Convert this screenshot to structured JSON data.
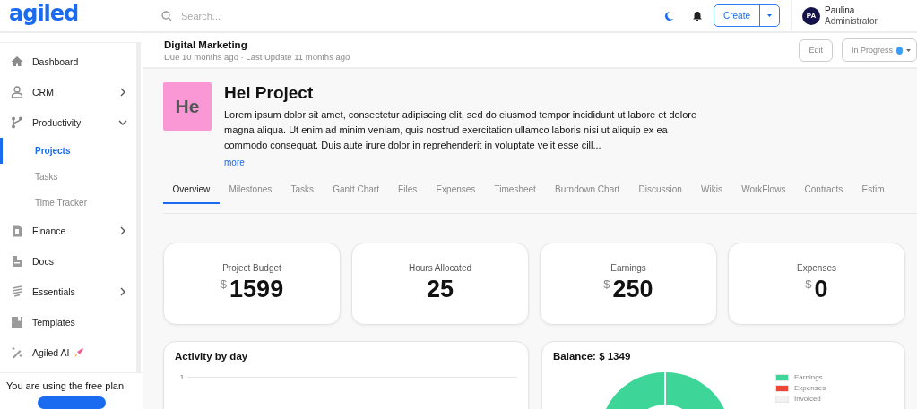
{
  "header": {
    "logo": "agiled",
    "search": {
      "placeholder": "Search..."
    },
    "create_button": "Create",
    "user": {
      "initials": "PA",
      "name": "Paulina",
      "role": "Administrator"
    }
  },
  "sidebar": {
    "items": [
      {
        "label": "Dashboard",
        "kind": "link",
        "selected": false
      },
      {
        "label": "CRM",
        "kind": "group",
        "expanded": false,
        "selected": false
      },
      {
        "label": "Productivity",
        "kind": "group",
        "expanded": true,
        "selected": false,
        "children": [
          {
            "label": "Projects",
            "selected": true
          },
          {
            "label": "Tasks",
            "selected": false
          },
          {
            "label": "Time Tracker",
            "selected": false
          }
        ]
      },
      {
        "label": "Finance",
        "kind": "group",
        "expanded": false,
        "selected": false
      },
      {
        "label": "Docs",
        "kind": "link",
        "selected": false
      },
      {
        "label": "Essentials",
        "kind": "group",
        "expanded": false,
        "selected": false
      },
      {
        "label": "Templates",
        "kind": "link",
        "selected": false
      },
      {
        "label": "Agiled AI",
        "kind": "link",
        "selected": false,
        "rocket": true
      }
    ],
    "banner": "You are using the free plan."
  },
  "project": {
    "title": "Digital Marketing",
    "meta": "Due 10 months ago · Last Update 11 months ago",
    "edit_button": "Edit",
    "status": "In Progress",
    "avatar": "He",
    "name": "Hel Project",
    "description": "Lorem ipsum dolor sit amet, consectetur adipiscing elit, sed do eiusmod tempor incididunt ut labore et dolore magna aliqua. Ut enim ad minim veniam, quis nostrud exercitation ullamco laboris nisi ut aliquip ex ea commodo consequat. Duis aute irure dolor in reprehenderit in voluptate velit esse cill...",
    "more_link": "more"
  },
  "tabs": [
    {
      "label": "Overview",
      "selected": true
    },
    {
      "label": "Milestones",
      "selected": false
    },
    {
      "label": "Tasks",
      "selected": false
    },
    {
      "label": "Gantt Chart",
      "selected": false
    },
    {
      "label": "Files",
      "selected": false
    },
    {
      "label": "Expenses",
      "selected": false
    },
    {
      "label": "Timesheet",
      "selected": false
    },
    {
      "label": "Burndown Chart",
      "selected": false
    },
    {
      "label": "Discussion",
      "selected": false
    },
    {
      "label": "Wikis",
      "selected": false
    },
    {
      "label": "WorkFlows",
      "selected": false
    },
    {
      "label": "Contracts",
      "selected": false
    },
    {
      "label": "Estim",
      "selected": false
    }
  ],
  "stats": [
    {
      "label": "Project Budget",
      "currency": "$",
      "value": "1599"
    },
    {
      "label": "Hours Allocated",
      "value": "25"
    },
    {
      "label": "Earnings",
      "currency": "$",
      "value": "250"
    },
    {
      "label": "Expenses",
      "currency": "$",
      "value": "0"
    }
  ],
  "activity": {
    "title": "Activity by day",
    "y_tick": "1"
  },
  "balance": {
    "title": "Balance: $ 1349",
    "legend": [
      {
        "label": "Earnings",
        "color": "#3dd598"
      },
      {
        "label": "Expenses",
        "color": "#f04438"
      },
      {
        "label": "Invoiced",
        "color": "#f2f2f2"
      }
    ]
  }
}
